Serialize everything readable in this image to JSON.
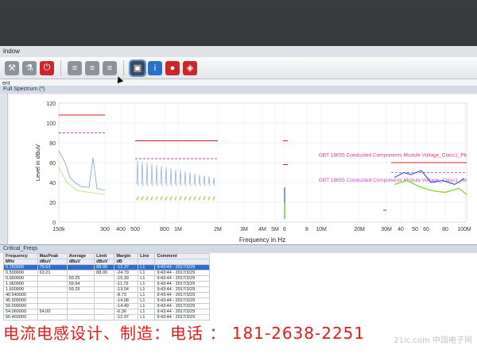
{
  "window": {
    "title": "indow"
  },
  "toolbar": {
    "buttons": [
      {
        "name": "tools-icon",
        "style": "grey",
        "glyph": "⚒"
      },
      {
        "name": "lab-icon",
        "style": "grey",
        "glyph": "⚗"
      },
      {
        "name": "power-icon",
        "style": "red",
        "glyph": "⏻"
      },
      {
        "name": "db-icon-1",
        "style": "grey",
        "glyph": "≡"
      },
      {
        "name": "db-icon-2",
        "style": "grey",
        "glyph": "≡"
      },
      {
        "name": "db-icon-3",
        "style": "grey",
        "glyph": "≡"
      },
      {
        "name": "scan-icon",
        "style": "dark",
        "glyph": "▣"
      },
      {
        "name": "info-icon",
        "style": "blue",
        "glyph": "i"
      },
      {
        "name": "record-icon",
        "style": "red",
        "glyph": "●"
      },
      {
        "name": "export-icon",
        "style": "red",
        "glyph": "◈"
      }
    ]
  },
  "tabs": {
    "main": "ent",
    "spectrum": "Full Spectrum (*)"
  },
  "chart_data": {
    "type": "line",
    "ylabel": "Level in dBuV",
    "xlabel": "Frequency in Hz",
    "ylim": [
      0,
      120
    ],
    "yticks": [
      "120",
      "100",
      "80",
      "60",
      "40",
      "20",
      "0"
    ],
    "xticks": [
      "150k",
      "300",
      "400",
      "500",
      "800",
      "1M",
      "2M",
      "3M",
      "4M",
      "5M",
      "6",
      "8",
      "10M",
      "20M",
      "30M",
      "40",
      "50",
      "60",
      "80",
      "100M"
    ],
    "annotations": [
      {
        "text": "GBT 18655 Conducted Components Module Voltage_Class1_Pk",
        "color": "#d23a8a"
      },
      {
        "text": "GBT 18655 Conducted Components Module Voltage_Class1_Av",
        "color": "#c24cc9"
      }
    ],
    "limit_lines": [
      {
        "name": "Peak limit",
        "color": "#d12222",
        "segments": [
          {
            "x": [
              "150k",
              "300"
            ],
            "y": 108
          },
          {
            "x": [
              "500",
              "2M"
            ],
            "y": 82
          }
        ]
      },
      {
        "name": "Average limit",
        "color": "#b042c0",
        "segments": [
          {
            "x": [
              "150k",
              "300"
            ],
            "y": 90
          },
          {
            "x": [
              "500",
              "2M"
            ],
            "y": 64
          }
        ]
      }
    ],
    "grid": true
  },
  "results": {
    "title": "Critical_Freqs",
    "columns": [
      "Frequency",
      "MaxPeak",
      "Average",
      "Limit",
      "Margin",
      "Line",
      "Comment"
    ],
    "units": [
      "MHz",
      "dBuV",
      "dBuV",
      "dBuV",
      "dB",
      "",
      ""
    ],
    "rows": [
      [
        "0.150000",
        "75.63",
        "",
        "88.00",
        "-12.37",
        "L1",
        "9:43:44 - 2017/3/29"
      ],
      [
        "0.500000",
        "63.21",
        "",
        "88.00",
        "-24.79",
        "L1",
        "9:43:44 - 2017/3/29"
      ],
      [
        "0.990000",
        "",
        "50.25",
        "",
        "-15.39",
        "L1",
        "9:43:44 - 2017/3/29"
      ],
      [
        "1.060000",
        "",
        "59.94",
        "",
        "-11.76",
        "L1",
        "9:43:44 - 2017/3/29"
      ],
      [
        "1.600000",
        "",
        "59.29",
        "",
        "-13.04",
        "L1",
        "9:43:44 - 2017/3/29"
      ],
      [
        "40.540000",
        "",
        "",
        "",
        "-8.73",
        "L1",
        "9:43:44 - 2017/3/29"
      ],
      [
        "45.500000",
        "",
        "",
        "",
        "-14.08",
        "L1",
        "9:43:44 - 2017/3/29"
      ],
      [
        "50.000000",
        "",
        "",
        "",
        "-14.49",
        "L1",
        "9:43:44 - 2017/3/29"
      ],
      [
        "54.060000",
        "54.00",
        "",
        "",
        "-6.36",
        "L1",
        "9:43:44 - 2017/3/29"
      ],
      [
        "60.460000",
        "",
        "",
        "",
        "-12.97",
        "L1",
        "9:43:44 - 2017/3/29"
      ]
    ]
  },
  "banner": {
    "text": "电流电感设计、制造：电话 ： 181-2638-2251"
  },
  "watermark": {
    "text": "21ic.com 中国电子网"
  }
}
